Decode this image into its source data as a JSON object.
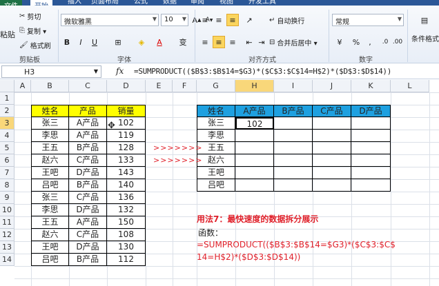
{
  "tabs": [
    "文件",
    "开始",
    "插入",
    "页面布局",
    "公式",
    "数据",
    "审阅",
    "视图",
    "开发工具"
  ],
  "ribbon": {
    "clipboard": {
      "paste": "粘贴",
      "cut": "剪切",
      "copy": "复制 ▾",
      "format_painter": "格式刷",
      "label": "剪贴板"
    },
    "font": {
      "name": "微软雅黑",
      "size": "10",
      "bold": "B",
      "italic": "I",
      "underline": "U",
      "label": "字体"
    },
    "alignment": {
      "wrap": "自动换行",
      "merge": "合并后居中 ▾",
      "label": "对齐方式"
    },
    "number": {
      "format": "常规",
      "percent": "%",
      "comma": ",",
      "label": "数字"
    },
    "styles": {
      "conditional": "条件格式"
    }
  },
  "formula_bar": {
    "name_box": "H3",
    "fx": "fx",
    "formula": "=SUMPRODUCT(($B$3:$B$14=$G3)*($C$3:$C$14=H$2)*($D$3:$D$14))"
  },
  "columns": [
    "A",
    "B",
    "C",
    "D",
    "E",
    "F",
    "G",
    "H",
    "I",
    "J",
    "K",
    "L"
  ],
  "rows": [
    "1",
    "2",
    "3",
    "4",
    "5",
    "6",
    "7",
    "8",
    "9",
    "10",
    "11",
    "12",
    "13",
    "14"
  ],
  "left_table": {
    "headers": [
      "姓名",
      "产品",
      "销量"
    ],
    "rows": [
      [
        "张三",
        "A产品",
        "102"
      ],
      [
        "李思",
        "A产品",
        "119"
      ],
      [
        "王五",
        "B产品",
        "128"
      ],
      [
        "赵六",
        "C产品",
        "133"
      ],
      [
        "王吧",
        "D产品",
        "143"
      ],
      [
        "吕吧",
        "B产品",
        "140"
      ],
      [
        "张三",
        "C产品",
        "136"
      ],
      [
        "李思",
        "D产品",
        "132"
      ],
      [
        "王五",
        "A产品",
        "150"
      ],
      [
        "赵六",
        "C产品",
        "108"
      ],
      [
        "王吧",
        "D产品",
        "130"
      ],
      [
        "吕吧",
        "B产品",
        "112"
      ]
    ]
  },
  "right_table": {
    "headers": [
      "姓名",
      "A产品",
      "B产品",
      "C产品",
      "D产品"
    ],
    "rows": [
      [
        "张三",
        "102",
        "",
        "",
        ""
      ],
      [
        "李思",
        "",
        "",
        "",
        ""
      ],
      [
        "王五",
        "",
        "",
        "",
        ""
      ],
      [
        "赵六",
        "",
        "",
        "",
        ""
      ],
      [
        "王吧",
        "",
        "",
        "",
        ""
      ],
      [
        "吕吧",
        "",
        "",
        "",
        ""
      ]
    ]
  },
  "arrows": [
    ">>>>>>>",
    ">>>>>>>"
  ],
  "note": {
    "title": "用法7：最快速度的数据拆分展示",
    "label": "函数：",
    "line1": "=SUMPRODUCT(($B$3:$B$14=$G3)*($C$3:$C$",
    "line2": "14=H$2)*($D$3:$D$14))"
  },
  "colors": {
    "header_yellow": "#ffff00",
    "header_blue": "#1ea0e0",
    "accent_red": "#e0202a"
  }
}
